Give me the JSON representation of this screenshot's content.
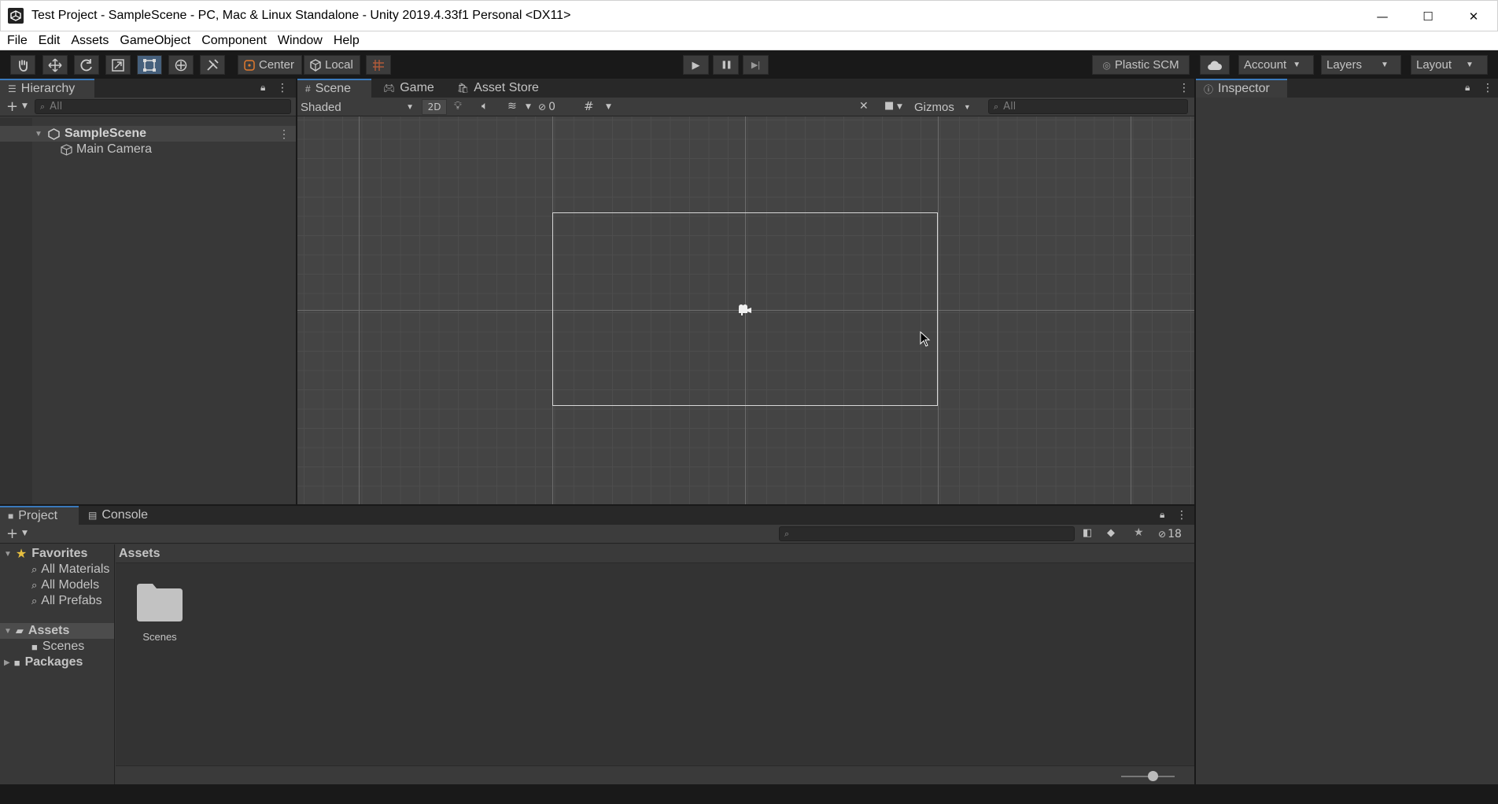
{
  "window": {
    "title": "Test Project - SampleScene - PC, Mac & Linux Standalone - Unity 2019.4.33f1 Personal <DX11>",
    "minimize_glyph": "—",
    "maximize_glyph": "☐",
    "close_glyph": "✕"
  },
  "menu": [
    "File",
    "Edit",
    "Assets",
    "GameObject",
    "Component",
    "Window",
    "Help"
  ],
  "toolbar": {
    "tools": [
      "hand-tool-icon",
      "move-tool-icon",
      "rotate-tool-icon",
      "scale-tool-icon",
      "rect-tool-icon",
      "transform-tool-icon",
      "custom-tool-icon"
    ],
    "active_tool": "rect-tool-icon",
    "pivot_label": "Center",
    "space_label": "Local",
    "play_glyph": "▶",
    "pause_glyph": "❚❚",
    "step_glyph": "▶|",
    "plastic_label": "Plastic SCM",
    "account_label": "Account",
    "layers_label": "Layers",
    "layout_label": "Layout"
  },
  "hierarchy": {
    "tab_label": "Hierarchy",
    "search_placeholder": "All",
    "scene_name": "SampleScene",
    "items": [
      "Main Camera"
    ]
  },
  "scene_view": {
    "tabs": [
      "Scene",
      "Game",
      "Asset Store"
    ],
    "active_tab": "Scene",
    "shading_mode": "Shaded",
    "mode_2d_label": "2D",
    "hidden_count": "0",
    "gizmos_label": "Gizmos",
    "search_placeholder": "All"
  },
  "inspector": {
    "tab_label": "Inspector"
  },
  "project": {
    "tabs": [
      "Project",
      "Console"
    ],
    "active_tab": "Project",
    "hidden_count": "18",
    "favorites_label": "Favorites",
    "favorites": [
      "All Materials",
      "All Models",
      "All Prefabs"
    ],
    "tree": {
      "assets_label": "Assets",
      "assets_children": [
        "Scenes"
      ],
      "packages_label": "Packages"
    },
    "breadcrumb": "Assets",
    "grid_items": [
      {
        "label": "Scenes",
        "icon": "folder-icon"
      }
    ]
  }
}
